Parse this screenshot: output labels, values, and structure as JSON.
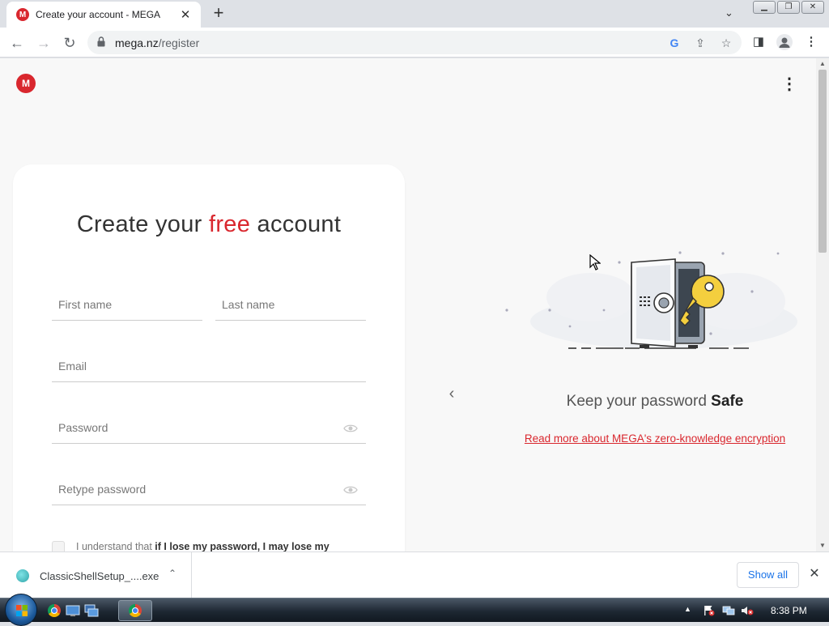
{
  "browser": {
    "tab": {
      "favicon": "M",
      "title": "Create your account - MEGA"
    },
    "newtab_label": "+",
    "url_domain": "mega.nz",
    "url_path": "/register",
    "window_buttons": [
      "▭",
      "⧉",
      "✕"
    ]
  },
  "page": {
    "logo": "M",
    "menu_icon": "⋮",
    "form": {
      "title_pre": "Create your ",
      "title_free": "free",
      "title_post": " account",
      "first_name_placeholder": "First name",
      "last_name_placeholder": "Last name",
      "email_placeholder": "Email",
      "password_placeholder": "Password",
      "retype_placeholder": "Retype password",
      "terms_pre": "I understand that ",
      "terms_bold": "if I lose my password, I may lose my"
    },
    "slide": {
      "prev_arrow": "‹",
      "title_pre": "Keep your password ",
      "title_bold": "Safe",
      "link": "Read more about MEGA's zero-knowledge encryption"
    }
  },
  "downloads": {
    "file_name": "ClassicShellSetup_....exe",
    "chevron": "⌃",
    "show_all": "Show all",
    "close": "✕"
  },
  "taskbar": {
    "clock": "8:38 PM"
  }
}
